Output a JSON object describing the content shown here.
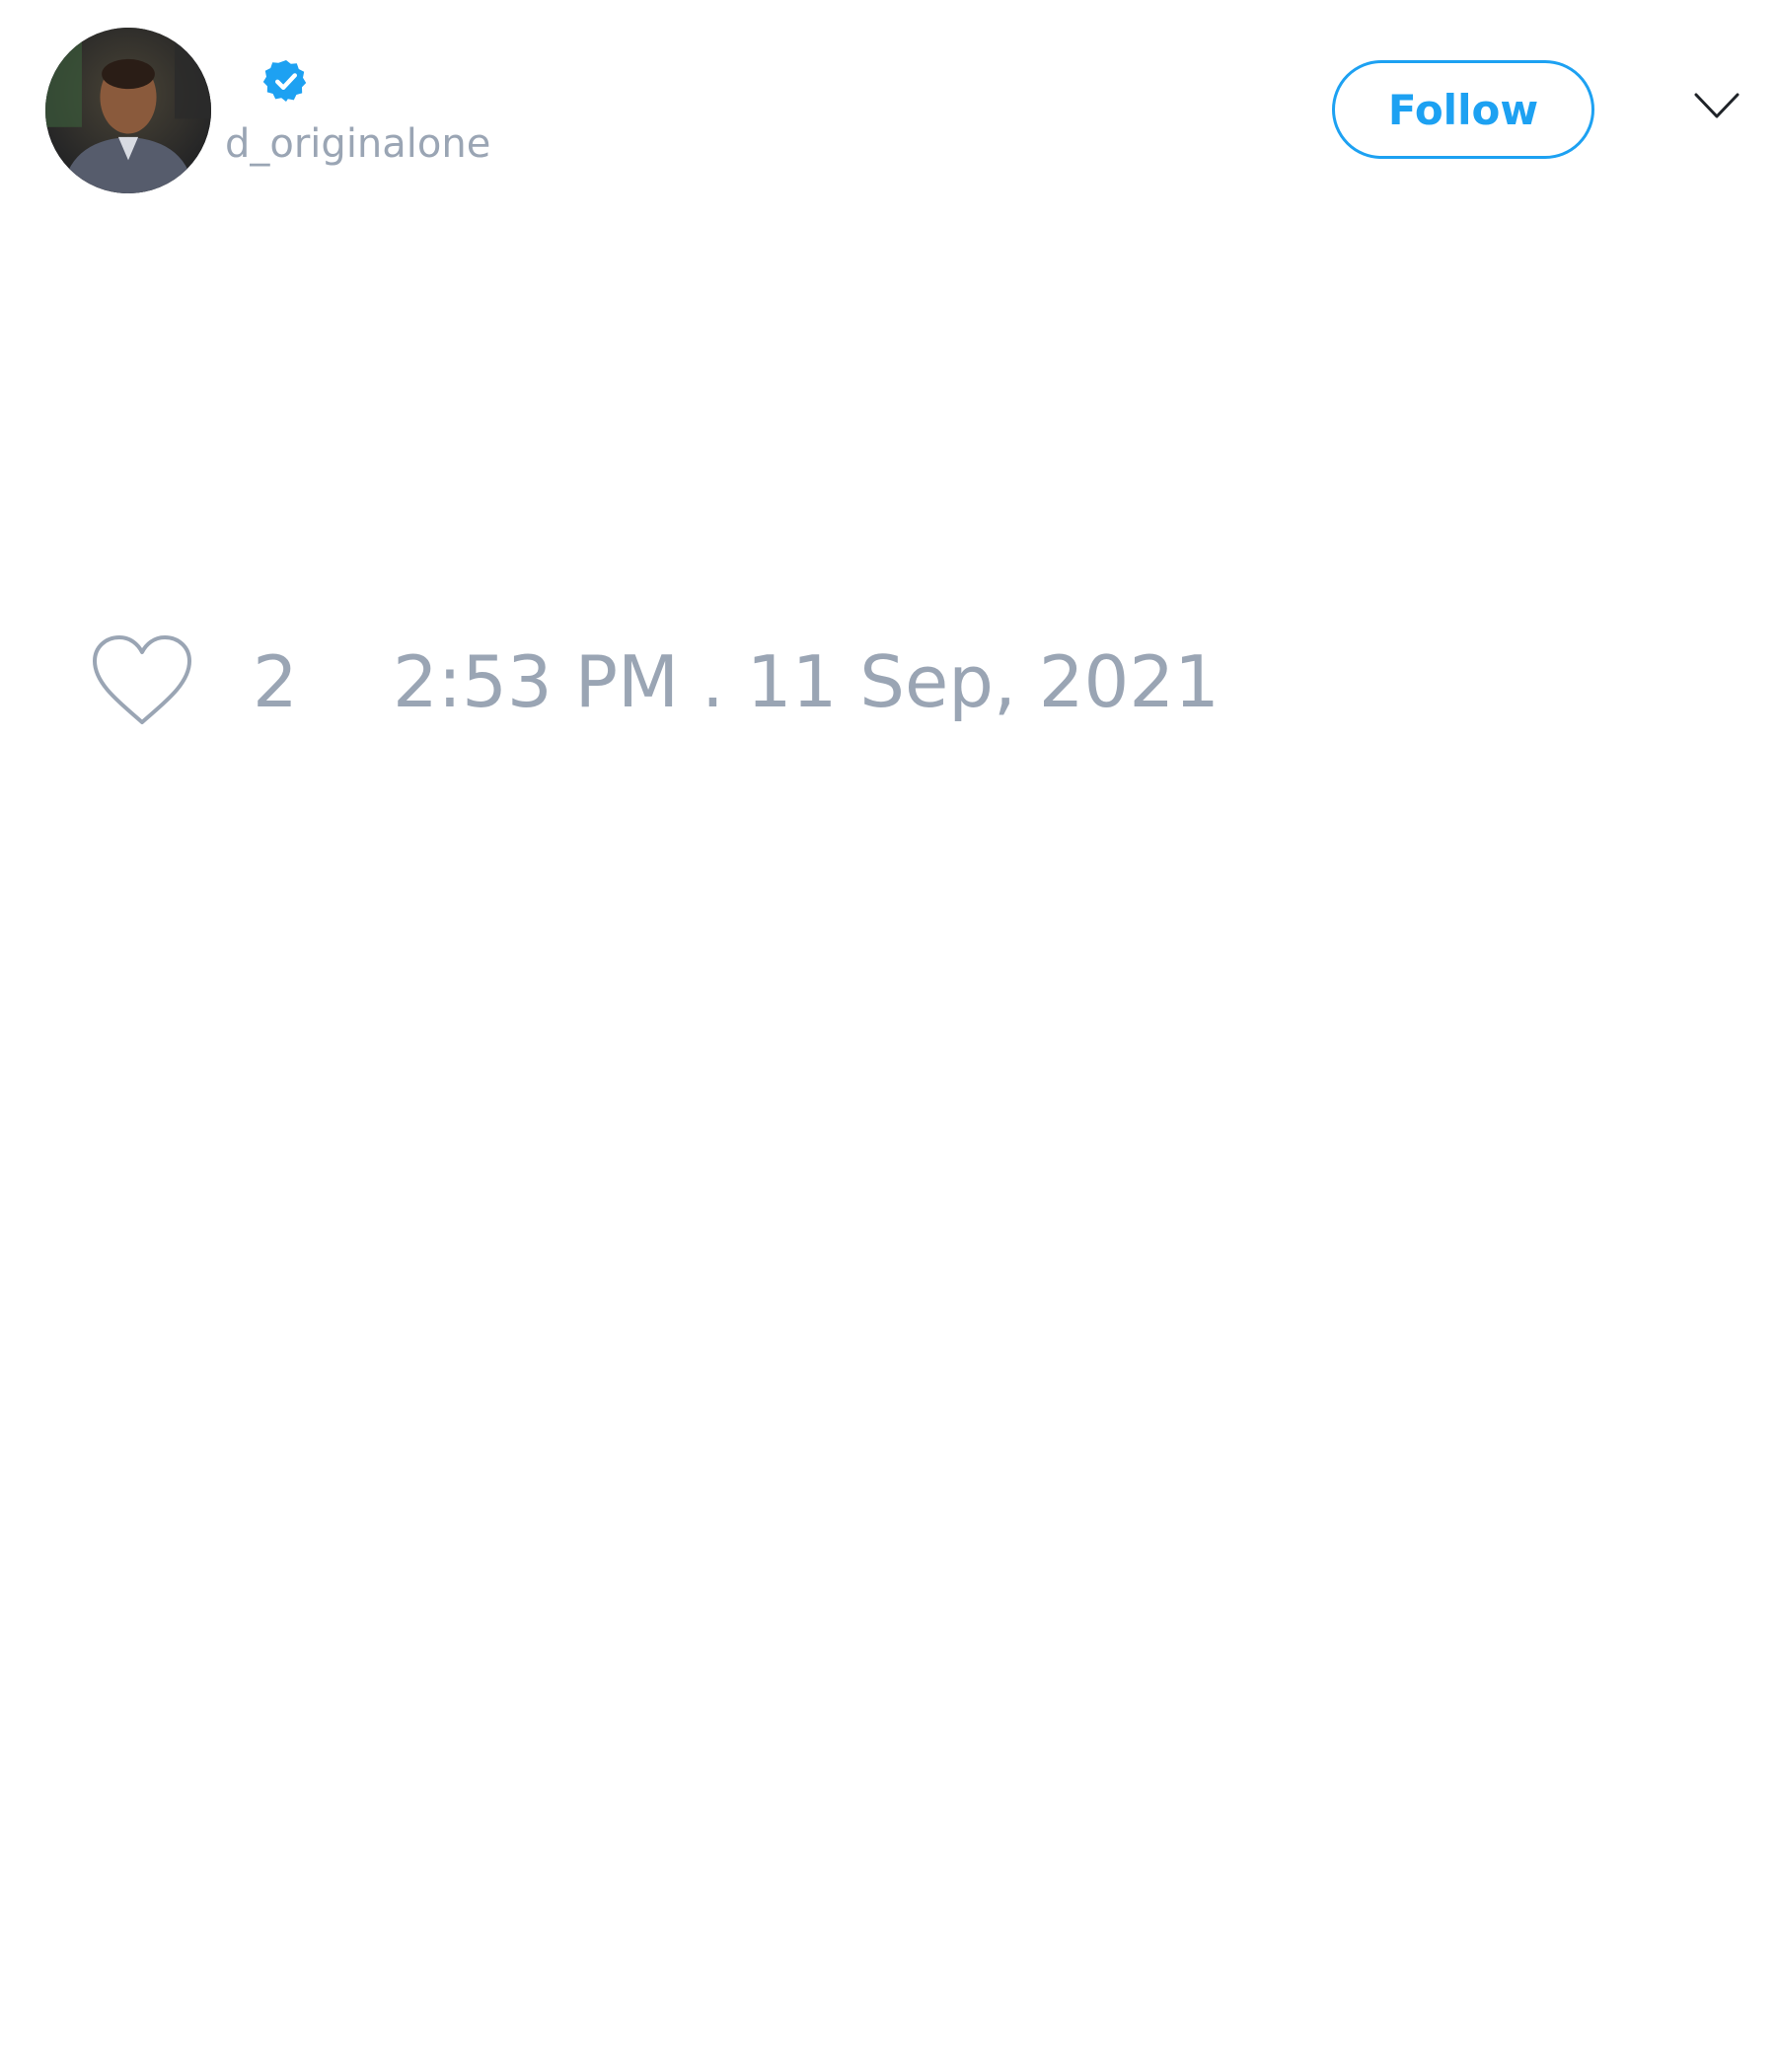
{
  "header": {
    "handle": "d_originalone",
    "verified": true,
    "follow_label": "Follow",
    "avatar_icon": "user-photo-avatar",
    "menu_icon": "chevron-down-icon"
  },
  "footer": {
    "like_icon": "heart-icon",
    "like_count": "2",
    "timestamp": "2:53 PM . 11 Sep, 2021"
  },
  "colors": {
    "accent": "#1da1f2",
    "muted_text": "#9aa5b4",
    "background": "#ffffff"
  }
}
